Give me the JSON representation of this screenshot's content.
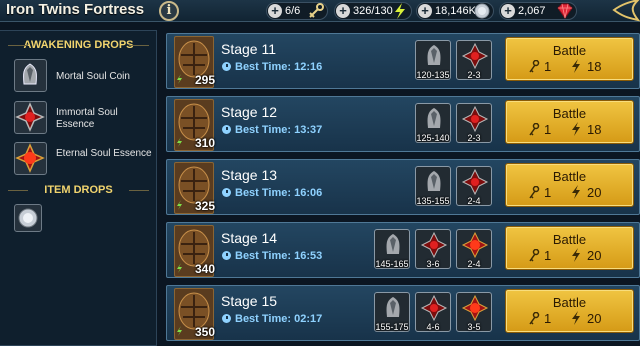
{
  "header": {
    "title": "Iron Twins Fortress",
    "info_glyph": "i",
    "resources": [
      {
        "value": "6/6",
        "icon": "key-icon"
      },
      {
        "value": "326/130",
        "icon": "energy-bolt-icon"
      },
      {
        "value": "18,146K",
        "icon": "silver-coin-icon"
      },
      {
        "value": "2,067",
        "icon": "ruby-gem-icon"
      }
    ],
    "plus_glyph": "+"
  },
  "left_panel": {
    "awakening_heading": "AWAKENING DROPS",
    "awakening_items": [
      {
        "label": "Mortal Soul Coin",
        "icon": "mortal-soul-coin-icon"
      },
      {
        "label": "Immortal Soul Essence",
        "icon": "immortal-soul-essence-icon"
      },
      {
        "label": "Eternal Soul Essence",
        "icon": "eternal-soul-essence-icon"
      }
    ],
    "item_heading": "ITEM DROPS",
    "item_drops": [
      {
        "icon": "silver-coin-icon"
      }
    ]
  },
  "stages": [
    {
      "name": "Stage 11",
      "power": "295",
      "best_time_label": "Best Time: 12:16",
      "drops": [
        {
          "icon": "mortal-soul-coin-icon",
          "count": "120-135"
        },
        {
          "icon": "immortal-soul-essence-icon",
          "count": "2-3"
        }
      ],
      "battle": {
        "label": "Battle",
        "keys": "1",
        "energy": "18"
      }
    },
    {
      "name": "Stage 12",
      "power": "310",
      "best_time_label": "Best Time: 13:37",
      "drops": [
        {
          "icon": "mortal-soul-coin-icon",
          "count": "125-140"
        },
        {
          "icon": "immortal-soul-essence-icon",
          "count": "2-3"
        }
      ],
      "battle": {
        "label": "Battle",
        "keys": "1",
        "energy": "18"
      }
    },
    {
      "name": "Stage 13",
      "power": "325",
      "best_time_label": "Best Time: 16:06",
      "drops": [
        {
          "icon": "mortal-soul-coin-icon",
          "count": "135-155"
        },
        {
          "icon": "immortal-soul-essence-icon",
          "count": "2-4"
        }
      ],
      "battle": {
        "label": "Battle",
        "keys": "1",
        "energy": "20"
      }
    },
    {
      "name": "Stage 14",
      "power": "340",
      "best_time_label": "Best Time: 16:53",
      "drops": [
        {
          "icon": "mortal-soul-coin-icon",
          "count": "145-165"
        },
        {
          "icon": "immortal-soul-essence-icon",
          "count": "3-6"
        },
        {
          "icon": "eternal-soul-essence-icon",
          "count": "2-4"
        }
      ],
      "battle": {
        "label": "Battle",
        "keys": "1",
        "energy": "20"
      }
    },
    {
      "name": "Stage 15",
      "power": "350",
      "best_time_label": "Best Time: 02:17",
      "drops": [
        {
          "icon": "mortal-soul-coin-icon",
          "count": "155-175"
        },
        {
          "icon": "immortal-soul-essence-icon",
          "count": "4-6"
        },
        {
          "icon": "eternal-soul-essence-icon",
          "count": "3-5"
        }
      ],
      "battle": {
        "label": "Battle",
        "keys": "1",
        "energy": "20"
      }
    }
  ],
  "colors": {
    "accent_gold": "#f0c542",
    "best_time_blue": "#8fd2ff",
    "heading_gold": "#f1d46e"
  }
}
